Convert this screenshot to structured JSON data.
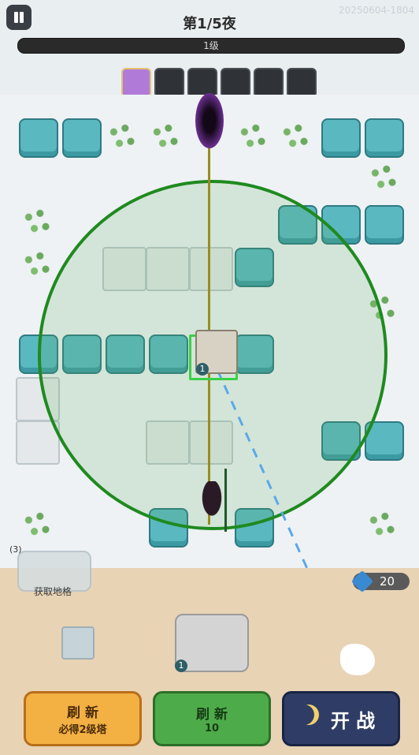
{
  "header": {
    "title": "第1/5夜",
    "build_id": "20250604-1804",
    "level_label": "1级"
  },
  "field": {
    "tower_level": "1"
  },
  "inventory": {
    "get_grid_label": "获取地格",
    "ad_count": "(3)",
    "gems": "20",
    "stove_level": "1"
  },
  "buttons": {
    "refresh_ad": {
      "top": "刷 新",
      "bottom": "必得2级塔"
    },
    "refresh_gem": {
      "top": "刷 新",
      "bottom": "10"
    },
    "start": {
      "label": "开 战"
    }
  },
  "colors": {
    "range_circle": "#1f8a1f",
    "path": "#9b8c1f",
    "selection": "#39d046",
    "tile": "#5ab8c0"
  }
}
